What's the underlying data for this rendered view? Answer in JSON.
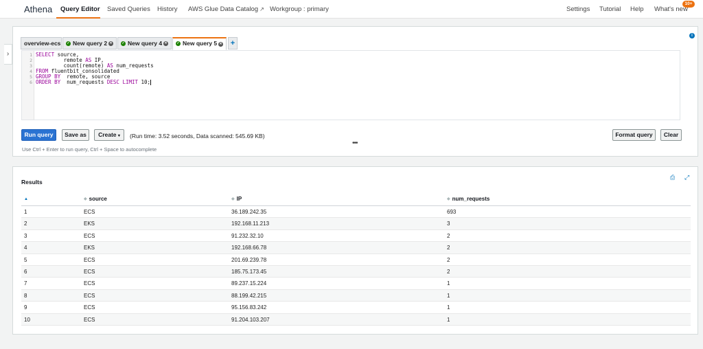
{
  "nav": {
    "brand": "Athena",
    "items": [
      "Query Editor",
      "Saved Queries",
      "History",
      "AWS Glue Data Catalog",
      "Workgroup : primary"
    ],
    "right_items": [
      "Settings",
      "Tutorial",
      "Help",
      "What's new"
    ],
    "whats_new_badge": "10+",
    "accent_color": "#ec7211"
  },
  "editor": {
    "tabs": [
      {
        "label": "overview-ecs",
        "status": "none",
        "closable": false
      },
      {
        "label": "New query 2",
        "status": "success-icon",
        "closable": true
      },
      {
        "label": "New query 4",
        "status": "success-icon",
        "closable": true
      },
      {
        "label": "New query 5",
        "status": "success-icon",
        "closable": true,
        "active": true
      }
    ],
    "add_tab_label": "+",
    "line_numbers": [
      "1",
      "2",
      "3",
      "4",
      "5",
      "6"
    ],
    "sql_lines": [
      "SELECT source,",
      "         remote AS IP,",
      "         count(remote) AS num_requests",
      "FROM fluentbit_consolidated",
      "GROUP BY  remote, source",
      "ORDER BY  num_requests DESC LIMIT 10;"
    ],
    "buttons": {
      "run": "Run query",
      "save": "Save as",
      "create": "Create",
      "format": "Format query",
      "clear": "Clear"
    },
    "run_info": "(Run time: 3.52 seconds, Data scanned: 545.69 KB)",
    "hint": "Use Ctrl + Enter to run query, Ctrl + Space to autocomplete"
  },
  "results": {
    "title": "Results",
    "columns": [
      "",
      "source",
      "IP",
      "num_requests"
    ],
    "rows": [
      [
        "1",
        "ECS",
        "36.189.242.35",
        "693"
      ],
      [
        "2",
        "EKS",
        "192.168.11.213",
        "3"
      ],
      [
        "3",
        "ECS",
        "91.232.32.10",
        "2"
      ],
      [
        "4",
        "EKS",
        "192.168.66.78",
        "2"
      ],
      [
        "5",
        "ECS",
        "201.69.239.78",
        "2"
      ],
      [
        "6",
        "ECS",
        "185.75.173.45",
        "2"
      ],
      [
        "7",
        "ECS",
        "89.237.15.224",
        "1"
      ],
      [
        "8",
        "ECS",
        "88.199.42.215",
        "1"
      ],
      [
        "9",
        "ECS",
        "95.156.83.242",
        "1"
      ],
      [
        "10",
        "ECS",
        "91.204.103.207",
        "1"
      ]
    ]
  }
}
